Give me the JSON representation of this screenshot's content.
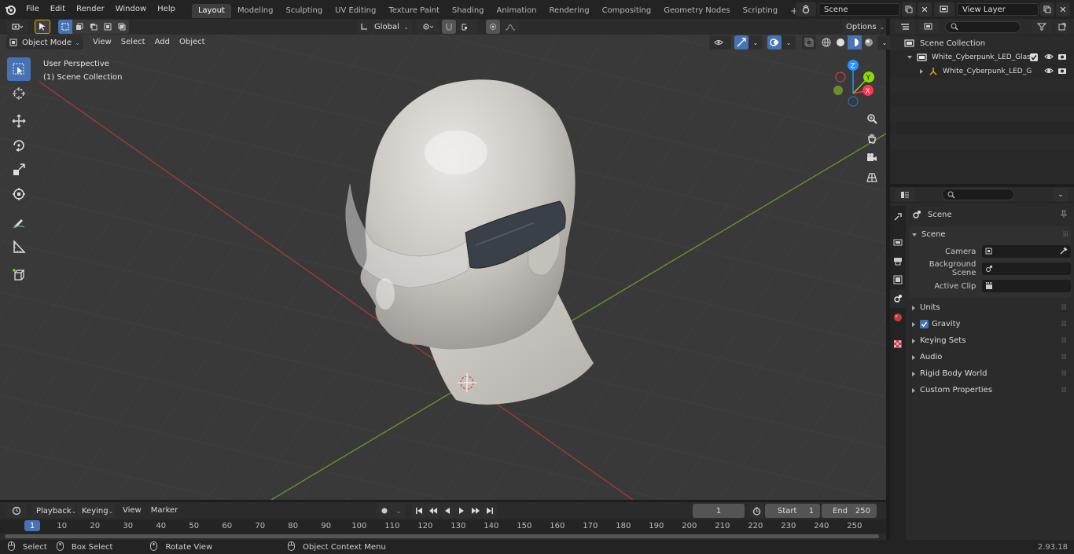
{
  "menu": [
    "File",
    "Edit",
    "Render",
    "Window",
    "Help"
  ],
  "workspaces": [
    "Layout",
    "Modeling",
    "Sculpting",
    "UV Editing",
    "Texture Paint",
    "Shading",
    "Animation",
    "Rendering",
    "Compositing",
    "Geometry Nodes",
    "Scripting"
  ],
  "active_workspace": "Layout",
  "scene_field": "Scene",
  "view_layer_field": "View Layer",
  "viewport_header": {
    "mode": "Object Mode",
    "menus": [
      "View",
      "Select",
      "Add",
      "Object"
    ],
    "transform_orientation": "Global",
    "options_label": "Options"
  },
  "viewport_info": {
    "perspective": "User Perspective",
    "collection": "(1) Scene Collection"
  },
  "gizmo": {
    "z": "Z",
    "y": "Y",
    "x": "X"
  },
  "outliner": {
    "root": "Scene Collection",
    "items": [
      {
        "label": "White_Cyberpunk_LED_Glass"
      },
      {
        "label": "White_Cyberpunk_LED_G"
      }
    ]
  },
  "properties": {
    "context": "Scene",
    "panel": "Scene",
    "rows": [
      {
        "label": "Camera"
      },
      {
        "label": "Background Scene"
      },
      {
        "label": "Active Clip"
      }
    ],
    "subpanels": [
      "Units",
      "Gravity",
      "Keying Sets",
      "Audio",
      "Rigid Body World",
      "Custom Properties"
    ]
  },
  "timeline": {
    "menus": [
      "Playback",
      "Keying",
      "View",
      "Marker"
    ],
    "current_frame": "1",
    "start_label": "Start",
    "start": "1",
    "end_label": "End",
    "end": "250",
    "ruler_labels": [
      "1",
      "10",
      "20",
      "30",
      "40",
      "50",
      "60",
      "70",
      "80",
      "90",
      "100",
      "110",
      "120",
      "130",
      "140",
      "150",
      "160",
      "170",
      "180",
      "190",
      "200",
      "210",
      "220",
      "230",
      "240",
      "250"
    ]
  },
  "statusbar": {
    "items": [
      "Select",
      "Box Select",
      "Rotate View",
      "Object Context Menu"
    ],
    "version": "2.93.18"
  },
  "colors": {
    "accent": "#4772b3",
    "x_axis": "#ff3352",
    "y_axis": "#8bdc00",
    "z_axis": "#2890ff"
  }
}
